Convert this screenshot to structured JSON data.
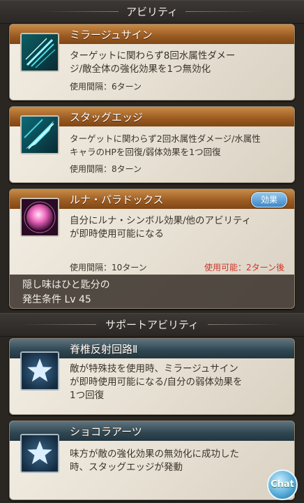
{
  "abilities_header": "アビリティ",
  "support_header": "サポートアビリティ",
  "abilities": [
    {
      "name": "ミラージュサイン",
      "desc_line1": "ターゲットに関わらず8回水属性ダメー",
      "desc_line2": "ジ/敵全体の強化効果を1つ無効化",
      "cooldown": "使用間隔：6ターン",
      "icon": "cyan-slash-icon"
    },
    {
      "name": "スタッグエッジ",
      "desc_line1": "ターゲットに関わらず2回水属性ダメージ/水属性",
      "desc_line2": "キャラのHPを回復/弱体効果を1つ回復",
      "cooldown": "使用間隔：8ターン",
      "icon": "cyan-blade-icon"
    },
    {
      "name": "ルナ・パラドックス",
      "badge": "効果",
      "desc_line1": "自分にルナ・シンボル効果/他のアビリティ",
      "desc_line2": "が即時使用可能になる",
      "cooldown": "使用間隔：10ターン",
      "availability": "使用可能：2ターン後",
      "hidden_line1": "隠し味はひと匙分の",
      "hidden_line2": "発生条件 Lv 45",
      "icon": "pink-orb-icon"
    }
  ],
  "support": [
    {
      "name": "脊椎反射回路Ⅱ",
      "desc_line1": "敵が特殊技を使用時、ミラージュサイン",
      "desc_line2": "が即時使用可能になる/自分の弱体効果を",
      "desc_line3": "1つ回復",
      "icon": "star-icon"
    },
    {
      "name": "ショコラアーツ",
      "desc_line1": "味方が敵の強化効果の無効化に成功した",
      "desc_line2": "時、スタッグエッジが発動",
      "icon": "star-icon"
    }
  ],
  "chat_label": "Chat"
}
